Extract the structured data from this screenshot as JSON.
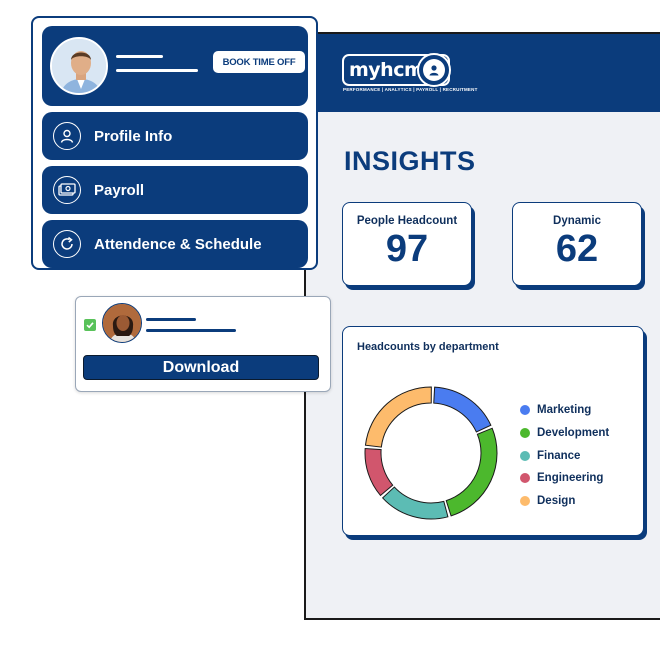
{
  "brand": {
    "logo_text": "myhcm",
    "tagline": "PERFORMANCE | ANALYTICS | PAYROLL | RECRUITMENT"
  },
  "dashboard": {
    "title": "INSIGHTS",
    "stats": [
      {
        "label": "People Headcount",
        "value": "97"
      },
      {
        "label": "Dynamic",
        "value": "62"
      }
    ],
    "chart_title": "Headcounts by department"
  },
  "menu": {
    "book_button": "BOOK TIME OFF",
    "items": [
      {
        "label": "Profile Info",
        "icon": "user-icon"
      },
      {
        "label": "Payroll",
        "icon": "cash-icon"
      },
      {
        "label": "Attendence & Schedule",
        "icon": "refresh-icon"
      }
    ]
  },
  "download_card": {
    "button_label": "Download",
    "checked": true
  },
  "colors": {
    "brand_navy": "#0b3c7c",
    "panel_bg": "#eff1f5",
    "check_green": "#59c25a"
  },
  "chart_data": {
    "type": "pie",
    "title": "Headcounts by department",
    "categories": [
      "Marketing",
      "Development",
      "Finance",
      "Engineering",
      "Design"
    ],
    "values": [
      18,
      27,
      18,
      13,
      24
    ],
    "colors": [
      "#4a7cf0",
      "#4cb82d",
      "#5cbcb4",
      "#d1566d",
      "#fdbb6c"
    ],
    "legend": "right",
    "donut": true
  }
}
